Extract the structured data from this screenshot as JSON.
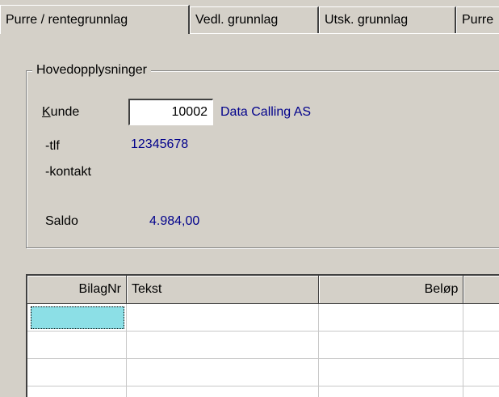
{
  "tabs": [
    {
      "label": "Purre / rentegrunnlag",
      "active": true
    },
    {
      "label": "Vedl. grunnlag",
      "active": false
    },
    {
      "label": "Utsk. grunnlag",
      "active": false
    },
    {
      "label": "Purre",
      "active": false
    }
  ],
  "group": {
    "title": "Hovedopplysninger",
    "kunde_label": "Kunde",
    "kunde_value": "10002",
    "kunde_name": "Data Calling AS",
    "tlf_label": "-tlf",
    "tlf_value": "12345678",
    "kontakt_label": "-kontakt",
    "saldo_label": "Saldo",
    "saldo_value": "4.984,00"
  },
  "grid": {
    "columns": [
      "BilagNr",
      "Tekst",
      "Beløp",
      ""
    ],
    "rows": [
      [
        "",
        "",
        "",
        ""
      ],
      [
        "",
        "",
        "",
        ""
      ],
      [
        "",
        "",
        "",
        ""
      ],
      [
        "",
        "",
        "",
        ""
      ]
    ]
  },
  "colors": {
    "face": "#d4d0c8",
    "value_text": "#00008b",
    "selected_cell": "#8cdfe6"
  }
}
